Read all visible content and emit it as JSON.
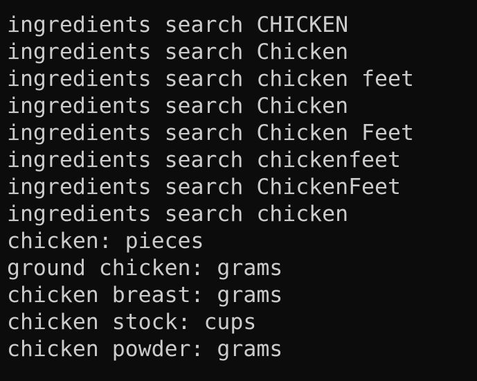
{
  "terminal": {
    "background": "#0c0c0c",
    "foreground": "#cccccc",
    "lines": [
      "ingredients search CHICKEN",
      "ingredients search Chicken",
      "ingredients search chicken feet",
      "ingredients search Chicken",
      "ingredients search Chicken Feet",
      "ingredients search chickenfeet",
      "ingredients search ChickenFeet",
      "ingredients search chicken",
      "chicken: pieces",
      "ground chicken: grams",
      "chicken breast: grams",
      "chicken stock: cups",
      "chicken powder: grams"
    ]
  }
}
